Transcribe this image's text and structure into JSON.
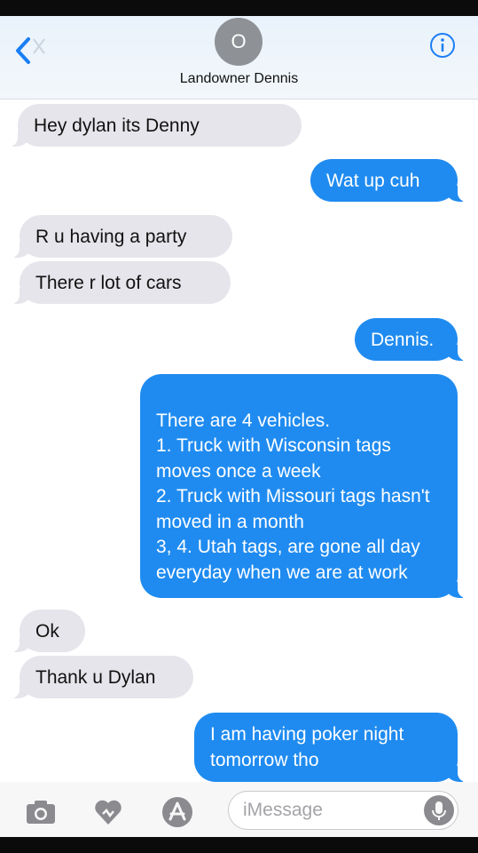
{
  "header": {
    "avatar_initial": "O",
    "contact_name": "Landowner Dennis",
    "back_icon": "chevron-left-icon",
    "info_icon": "info-icon"
  },
  "messages": [
    {
      "side": "in",
      "text": "Hey dylan its Denny"
    },
    {
      "side": "out",
      "text": "Wat up cuh"
    },
    {
      "side": "in",
      "text": "R u having a party"
    },
    {
      "side": "in",
      "text": "There r lot of cars"
    },
    {
      "side": "out",
      "text": "Dennis."
    },
    {
      "side": "out",
      "text": "There are 4 vehicles.\n1. Truck with Wisconsin tags moves once a week\n2.  Truck with Missouri tags hasn't moved in a month\n3, 4.  Utah tags, are gone all day everyday when we are at work"
    },
    {
      "side": "in",
      "text": "Ok"
    },
    {
      "side": "in",
      "text": "Thank u Dylan"
    },
    {
      "side": "out",
      "text": "I am having poker night tomorrow tho"
    }
  ],
  "composer": {
    "placeholder": "iMessage",
    "icons": [
      "camera-icon",
      "digital-touch-icon",
      "app-store-icon",
      "microphone-icon"
    ]
  },
  "colors": {
    "incoming_bubble": "#e6e5eb",
    "outgoing_bubble": "#1f8bf0"
  }
}
